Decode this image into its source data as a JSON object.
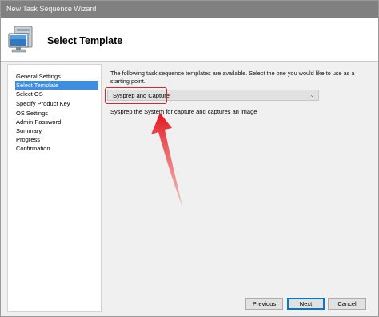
{
  "window": {
    "title": "New Task Sequence Wizard"
  },
  "header": {
    "heading": "Select Template",
    "icon": "computer-icon"
  },
  "sidebar": {
    "items": [
      {
        "label": "General Settings",
        "selected": false
      },
      {
        "label": "Select Template",
        "selected": true
      },
      {
        "label": "Select OS",
        "selected": false
      },
      {
        "label": "Specify Product Key",
        "selected": false
      },
      {
        "label": "OS Settings",
        "selected": false
      },
      {
        "label": "Admin Password",
        "selected": false
      },
      {
        "label": "Summary",
        "selected": false
      },
      {
        "label": "Progress",
        "selected": false
      },
      {
        "label": "Confirmation",
        "selected": false
      }
    ]
  },
  "main": {
    "intro": "The following task sequence templates are available.  Select the one you would like to use as a starting point.",
    "template_select": {
      "value": "Sysprep and Capture"
    },
    "description": "Sysprep the System for capture and captures an image"
  },
  "buttons": {
    "previous": "Previous",
    "next": "Next",
    "cancel": "Cancel"
  },
  "colors": {
    "highlight": "#d9262c",
    "selection": "#3d8ee0",
    "titlebar": "#808080"
  }
}
